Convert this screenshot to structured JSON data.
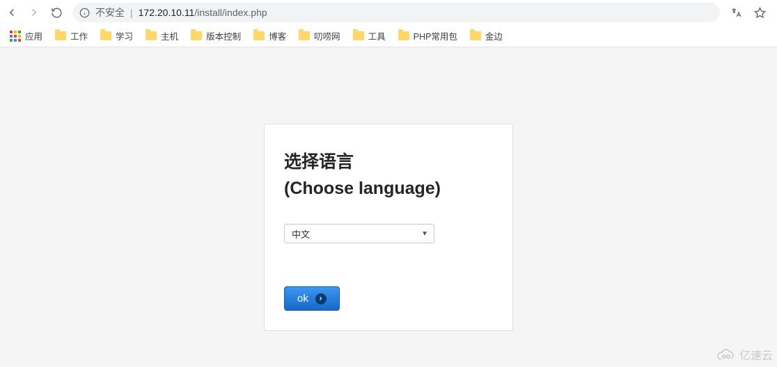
{
  "nav": {
    "insecure_label": "不安全",
    "url_host": "172.20.10.11",
    "url_path": "/install/index.php"
  },
  "bookmarks": {
    "apps_label": "应用",
    "items": [
      {
        "label": "工作"
      },
      {
        "label": "学习"
      },
      {
        "label": "主机"
      },
      {
        "label": "版本控制"
      },
      {
        "label": "博客"
      },
      {
        "label": "叨唠网"
      },
      {
        "label": "工具"
      },
      {
        "label": "PHP常用包"
      },
      {
        "label": "金边"
      }
    ]
  },
  "card": {
    "title_line1": "选择语言",
    "title_line2": "(Choose language)",
    "language_value": "中文",
    "ok_label": "ok"
  },
  "watermark": {
    "text": "亿速云"
  }
}
